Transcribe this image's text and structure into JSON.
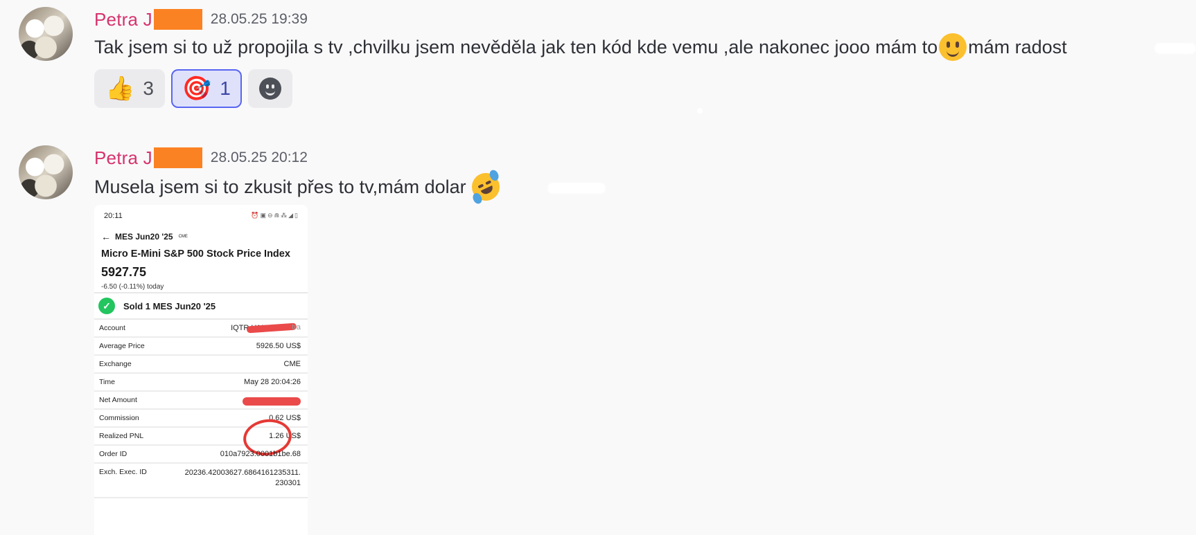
{
  "messages": [
    {
      "username": "Petra J",
      "timestamp": "28.05.25 19:39",
      "text_before": "Tak jsem si to už propojila s tv ,chvilku jsem nevěděla jak ten kód kde vemu ,ale nakonec jooo mám to",
      "inline_emoji": "slightly-smiling-face",
      "text_after": "mám radost",
      "reactions": [
        {
          "emoji": "👍",
          "icon": "thumbs-up-icon",
          "count": "3",
          "active": false
        },
        {
          "emoji": "🎯",
          "icon": "target-icon",
          "count": "1",
          "active": true
        }
      ],
      "add_reaction_icon": "add-reaction-icon"
    },
    {
      "username": "Petra J",
      "timestamp": "28.05.25 20:12",
      "text": "Musela jsem si to zkusit přes to tv,mám dolar",
      "inline_emoji": "rolling-on-floor-laughing",
      "attachment": {
        "status_time": "20:11",
        "nav_title": "MES Jun20 '25",
        "nav_tag": "CME",
        "instrument_name": "Micro E-Mini S&P 500 Stock Price Index",
        "price": "5927.75",
        "change": "-6.50 (-0.11%) today",
        "fill_text": "Sold 1 MES Jun20 '25",
        "rows": [
          {
            "label": "Account",
            "value": "IQTR U1158"
          },
          {
            "label": "Average Price",
            "value": "5926.50 US$"
          },
          {
            "label": "Exchange",
            "value": "CME"
          },
          {
            "label": "Time",
            "value": "May 28 20:04:26"
          },
          {
            "label": "Net Amount",
            "value": ""
          },
          {
            "label": "Commission",
            "value": "0.62 US$"
          },
          {
            "label": "Realized PNL",
            "value": "1.26 US$"
          },
          {
            "label": "Order ID",
            "value": "010a7923.0001b1be.68"
          },
          {
            "label": "Exch. Exec. ID",
            "value": "20236.42003627.6864161235311.",
            "value2": "230301"
          }
        ]
      }
    }
  ],
  "colors": {
    "username": "#d6336c",
    "redaction": "#fb8222",
    "reaction_active_border": "#5865f2",
    "scribble": "#ea4a4a",
    "fill_check": "#22c55e"
  }
}
